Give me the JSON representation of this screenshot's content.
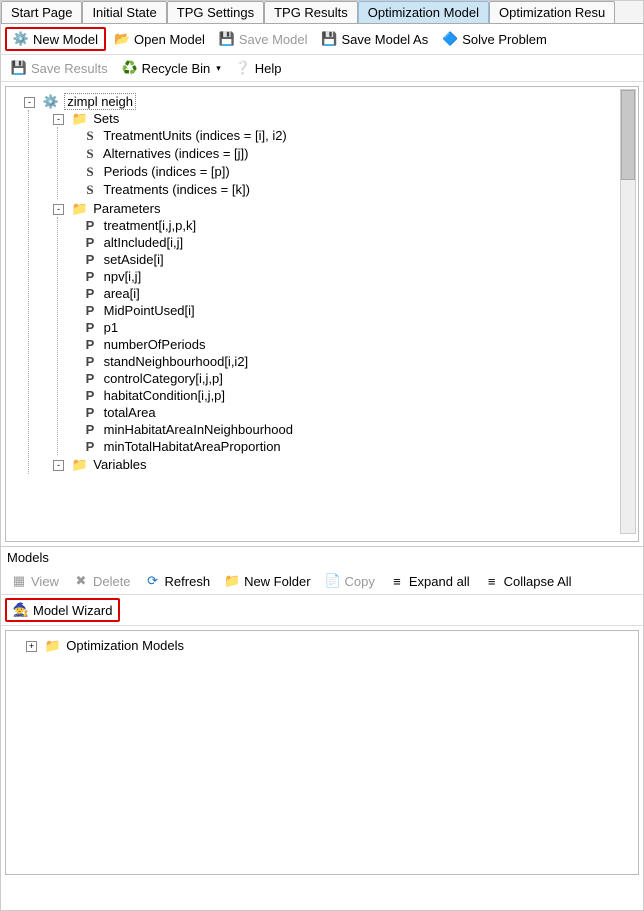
{
  "tabs": [
    "Start Page",
    "Initial State",
    "TPG Settings",
    "TPG Results",
    "Optimization Model",
    "Optimization Resu"
  ],
  "active_tab": 4,
  "tb1": {
    "new_model": "New Model",
    "open_model": "Open Model",
    "save_model": "Save Model",
    "save_model_as": "Save Model As",
    "solve_problem": "Solve Problem"
  },
  "tb2": {
    "save_results": "Save Results",
    "recycle_bin": "Recycle Bin",
    "help": "Help"
  },
  "tree": {
    "root": "zimpl neigh",
    "sets_label": "Sets",
    "sets": [
      "TreatmentUnits (indices = [i], i2)",
      "Alternatives (indices = [j])",
      "Periods (indices = [p])",
      "Treatments (indices = [k])"
    ],
    "params_label": "Parameters",
    "params": [
      "treatment[i,j,p,k]",
      "altIncluded[i,j]",
      "setAside[i]",
      "npv[i,j]",
      "area[i]",
      "MidPointUsed[i]",
      "p1",
      "numberOfPeriods",
      "standNeighbourhood[i,i2]",
      "controlCategory[i,j,p]",
      "habitatCondition[i,j,p]",
      "totalArea",
      "minHabitatAreaInNeighbourhood",
      "minTotalHabitatAreaProportion"
    ],
    "vars_label": "Variables"
  },
  "models": {
    "header": "Models",
    "view": "View",
    "delete": "Delete",
    "refresh": "Refresh",
    "new_folder": "New Folder",
    "copy": "Copy",
    "expand": "Expand all",
    "collapse": "Collapse All",
    "wizard": "Model Wizard",
    "root": "Optimization Models"
  }
}
